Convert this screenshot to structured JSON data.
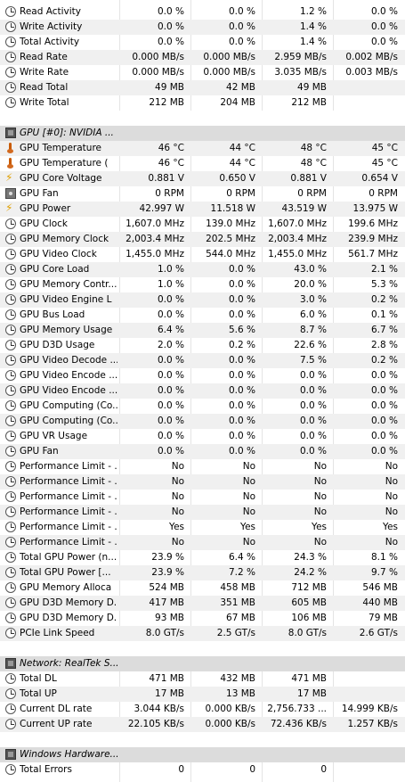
{
  "rows": [
    {
      "type": "item",
      "icon": "clock-icon",
      "label": "Read Activity",
      "v": [
        "0.0 %",
        "0.0 %",
        "1.2 %",
        "0.0 %"
      ]
    },
    {
      "type": "item",
      "icon": "clock-icon",
      "label": "Write Activity",
      "v": [
        "0.0 %",
        "0.0 %",
        "1.4 %",
        "0.0 %"
      ]
    },
    {
      "type": "item",
      "icon": "clock-icon",
      "label": "Total Activity",
      "v": [
        "0.0 %",
        "0.0 %",
        "1.4 %",
        "0.0 %"
      ]
    },
    {
      "type": "item",
      "icon": "clock-icon",
      "label": "Read Rate",
      "v": [
        "0.000 MB/s",
        "0.000 MB/s",
        "2.959 MB/s",
        "0.002 MB/s"
      ]
    },
    {
      "type": "item",
      "icon": "clock-icon",
      "label": "Write Rate",
      "v": [
        "0.000 MB/s",
        "0.000 MB/s",
        "3.035 MB/s",
        "0.003 MB/s"
      ]
    },
    {
      "type": "item",
      "icon": "clock-icon",
      "label": "Read Total",
      "v": [
        "49 MB",
        "42 MB",
        "49 MB",
        ""
      ]
    },
    {
      "type": "item",
      "icon": "clock-icon",
      "label": "Write Total",
      "v": [
        "212 MB",
        "204 MB",
        "212 MB",
        ""
      ]
    },
    {
      "type": "blank"
    },
    {
      "type": "section",
      "icon": "chip-icon",
      "label": "GPU [#0]: NVIDIA ..."
    },
    {
      "type": "item",
      "icon": "thermometer-icon",
      "label": "GPU Temperature",
      "v": [
        "46 °C",
        "44 °C",
        "48 °C",
        "45 °C"
      ]
    },
    {
      "type": "item",
      "icon": "thermometer-icon",
      "label": "GPU Temperature (",
      "v": [
        "46 °C",
        "44 °C",
        "48 °C",
        "45 °C"
      ]
    },
    {
      "type": "item",
      "icon": "lightning-icon",
      "label": "GPU Core Voltage",
      "v": [
        "0.881 V",
        "0.650 V",
        "0.881 V",
        "0.654 V"
      ]
    },
    {
      "type": "item",
      "icon": "fan-icon",
      "label": "GPU Fan",
      "v": [
        "0 RPM",
        "0 RPM",
        "0 RPM",
        "0 RPM"
      ]
    },
    {
      "type": "item",
      "icon": "lightning-icon",
      "label": "GPU Power",
      "v": [
        "42.997 W",
        "11.518 W",
        "43.519 W",
        "13.975 W"
      ]
    },
    {
      "type": "item",
      "icon": "clock-icon",
      "label": "GPU Clock",
      "v": [
        "1,607.0 MHz",
        "139.0 MHz",
        "1,607.0 MHz",
        "199.6 MHz"
      ]
    },
    {
      "type": "item",
      "icon": "clock-icon",
      "label": "GPU Memory Clock",
      "v": [
        "2,003.4 MHz",
        "202.5 MHz",
        "2,003.4 MHz",
        "239.9 MHz"
      ]
    },
    {
      "type": "item",
      "icon": "clock-icon",
      "label": "GPU Video Clock",
      "v": [
        "1,455.0 MHz",
        "544.0 MHz",
        "1,455.0 MHz",
        "561.7 MHz"
      ]
    },
    {
      "type": "item",
      "icon": "clock-icon",
      "label": "GPU Core Load",
      "v": [
        "1.0 %",
        "0.0 %",
        "43.0 %",
        "2.1 %"
      ]
    },
    {
      "type": "item",
      "icon": "clock-icon",
      "label": "GPU Memory Contr...",
      "v": [
        "1.0 %",
        "0.0 %",
        "20.0 %",
        "5.3 %"
      ]
    },
    {
      "type": "item",
      "icon": "clock-icon",
      "label": "GPU Video Engine L",
      "v": [
        "0.0 %",
        "0.0 %",
        "3.0 %",
        "0.2 %"
      ]
    },
    {
      "type": "item",
      "icon": "clock-icon",
      "label": "GPU Bus Load",
      "v": [
        "0.0 %",
        "0.0 %",
        "6.0 %",
        "0.1 %"
      ]
    },
    {
      "type": "item",
      "icon": "clock-icon",
      "label": "GPU Memory Usage",
      "v": [
        "6.4 %",
        "5.6 %",
        "8.7 %",
        "6.7 %"
      ]
    },
    {
      "type": "item",
      "icon": "clock-icon",
      "label": "GPU D3D Usage",
      "v": [
        "2.0 %",
        "0.2 %",
        "22.6 %",
        "2.8 %"
      ]
    },
    {
      "type": "item",
      "icon": "clock-icon",
      "label": "GPU Video Decode ...",
      "v": [
        "0.0 %",
        "0.0 %",
        "7.5 %",
        "0.2 %"
      ]
    },
    {
      "type": "item",
      "icon": "clock-icon",
      "label": "GPU Video Encode ...",
      "v": [
        "0.0 %",
        "0.0 %",
        "0.0 %",
        "0.0 %"
      ]
    },
    {
      "type": "item",
      "icon": "clock-icon",
      "label": "GPU Video Encode ...",
      "v": [
        "0.0 %",
        "0.0 %",
        "0.0 %",
        "0.0 %"
      ]
    },
    {
      "type": "item",
      "icon": "clock-icon",
      "label": "GPU Computing (Co...",
      "v": [
        "0.0 %",
        "0.0 %",
        "0.0 %",
        "0.0 %"
      ]
    },
    {
      "type": "item",
      "icon": "clock-icon",
      "label": "GPU Computing (Co...",
      "v": [
        "0.0 %",
        "0.0 %",
        "0.0 %",
        "0.0 %"
      ]
    },
    {
      "type": "item",
      "icon": "clock-icon",
      "label": "GPU VR Usage",
      "v": [
        "0.0 %",
        "0.0 %",
        "0.0 %",
        "0.0 %"
      ]
    },
    {
      "type": "item",
      "icon": "clock-icon",
      "label": "GPU Fan",
      "v": [
        "0.0 %",
        "0.0 %",
        "0.0 %",
        "0.0 %"
      ]
    },
    {
      "type": "item",
      "icon": "clock-icon",
      "label": "Performance Limit - ...",
      "v": [
        "No",
        "No",
        "No",
        "No"
      ]
    },
    {
      "type": "item",
      "icon": "clock-icon",
      "label": "Performance Limit - ...",
      "v": [
        "No",
        "No",
        "No",
        "No"
      ]
    },
    {
      "type": "item",
      "icon": "clock-icon",
      "label": "Performance Limit - ...",
      "v": [
        "No",
        "No",
        "No",
        "No"
      ]
    },
    {
      "type": "item",
      "icon": "clock-icon",
      "label": "Performance Limit - ...",
      "v": [
        "No",
        "No",
        "No",
        "No"
      ]
    },
    {
      "type": "item",
      "icon": "clock-icon",
      "label": "Performance Limit - ...",
      "v": [
        "Yes",
        "Yes",
        "Yes",
        "Yes"
      ]
    },
    {
      "type": "item",
      "icon": "clock-icon",
      "label": "Performance Limit - ...",
      "v": [
        "No",
        "No",
        "No",
        "No"
      ]
    },
    {
      "type": "item",
      "icon": "clock-icon",
      "label": "Total GPU Power (n...",
      "v": [
        "23.9 %",
        "6.4 %",
        "24.3 %",
        "8.1 %"
      ]
    },
    {
      "type": "item",
      "icon": "clock-icon",
      "label": "Total GPU Power [...",
      "v": [
        "23.9 %",
        "7.2 %",
        "24.2 %",
        "9.7 %"
      ]
    },
    {
      "type": "item",
      "icon": "clock-icon",
      "label": "GPU Memory Alloca",
      "v": [
        "524 MB",
        "458 MB",
        "712 MB",
        "546 MB"
      ]
    },
    {
      "type": "item",
      "icon": "clock-icon",
      "label": "GPU D3D Memory D...",
      "v": [
        "417 MB",
        "351 MB",
        "605 MB",
        "440 MB"
      ]
    },
    {
      "type": "item",
      "icon": "clock-icon",
      "label": "GPU D3D Memory D...",
      "v": [
        "93 MB",
        "67 MB",
        "106 MB",
        "79 MB"
      ]
    },
    {
      "type": "item",
      "icon": "clock-icon",
      "label": "PCIe Link Speed",
      "v": [
        "8.0 GT/s",
        "2.5 GT/s",
        "8.0 GT/s",
        "2.6 GT/s"
      ]
    },
    {
      "type": "blank"
    },
    {
      "type": "section",
      "icon": "chip-icon",
      "label": "Network: RealTek S..."
    },
    {
      "type": "item",
      "icon": "clock-icon",
      "label": "Total DL",
      "v": [
        "471 MB",
        "432 MB",
        "471 MB",
        ""
      ]
    },
    {
      "type": "item",
      "icon": "clock-icon",
      "label": "Total UP",
      "v": [
        "17 MB",
        "13 MB",
        "17 MB",
        ""
      ]
    },
    {
      "type": "item",
      "icon": "clock-icon",
      "label": "Current DL rate",
      "v": [
        "3.044 KB/s",
        "0.000 KB/s",
        "2,756.733 ...",
        "14.999 KB/s"
      ]
    },
    {
      "type": "item",
      "icon": "clock-icon",
      "label": "Current UP rate",
      "v": [
        "22.105 KB/s",
        "0.000 KB/s",
        "72.436 KB/s",
        "1.257 KB/s"
      ]
    },
    {
      "type": "blank"
    },
    {
      "type": "section",
      "icon": "chip-icon",
      "label": "Windows Hardware..."
    },
    {
      "type": "item",
      "icon": "clock-icon",
      "label": "Total Errors",
      "v": [
        "0",
        "0",
        "0",
        ""
      ]
    }
  ]
}
